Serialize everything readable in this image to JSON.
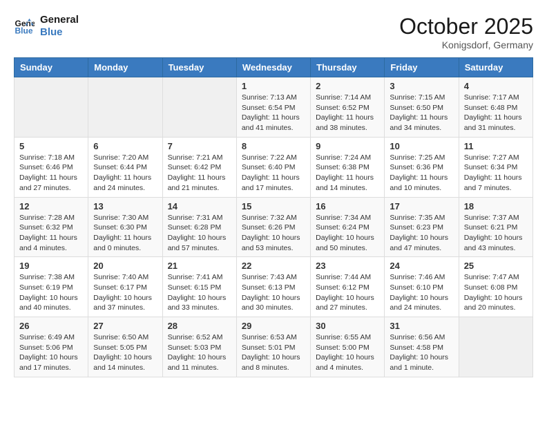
{
  "header": {
    "logo_general": "General",
    "logo_blue": "Blue",
    "month": "October 2025",
    "location": "Konigsdorf, Germany"
  },
  "weekdays": [
    "Sunday",
    "Monday",
    "Tuesday",
    "Wednesday",
    "Thursday",
    "Friday",
    "Saturday"
  ],
  "weeks": [
    [
      {
        "day": "",
        "content": ""
      },
      {
        "day": "",
        "content": ""
      },
      {
        "day": "",
        "content": ""
      },
      {
        "day": "1",
        "content": "Sunrise: 7:13 AM\nSunset: 6:54 PM\nDaylight: 11 hours and 41 minutes."
      },
      {
        "day": "2",
        "content": "Sunrise: 7:14 AM\nSunset: 6:52 PM\nDaylight: 11 hours and 38 minutes."
      },
      {
        "day": "3",
        "content": "Sunrise: 7:15 AM\nSunset: 6:50 PM\nDaylight: 11 hours and 34 minutes."
      },
      {
        "day": "4",
        "content": "Sunrise: 7:17 AM\nSunset: 6:48 PM\nDaylight: 11 hours and 31 minutes."
      }
    ],
    [
      {
        "day": "5",
        "content": "Sunrise: 7:18 AM\nSunset: 6:46 PM\nDaylight: 11 hours and 27 minutes."
      },
      {
        "day": "6",
        "content": "Sunrise: 7:20 AM\nSunset: 6:44 PM\nDaylight: 11 hours and 24 minutes."
      },
      {
        "day": "7",
        "content": "Sunrise: 7:21 AM\nSunset: 6:42 PM\nDaylight: 11 hours and 21 minutes."
      },
      {
        "day": "8",
        "content": "Sunrise: 7:22 AM\nSunset: 6:40 PM\nDaylight: 11 hours and 17 minutes."
      },
      {
        "day": "9",
        "content": "Sunrise: 7:24 AM\nSunset: 6:38 PM\nDaylight: 11 hours and 14 minutes."
      },
      {
        "day": "10",
        "content": "Sunrise: 7:25 AM\nSunset: 6:36 PM\nDaylight: 11 hours and 10 minutes."
      },
      {
        "day": "11",
        "content": "Sunrise: 7:27 AM\nSunset: 6:34 PM\nDaylight: 11 hours and 7 minutes."
      }
    ],
    [
      {
        "day": "12",
        "content": "Sunrise: 7:28 AM\nSunset: 6:32 PM\nDaylight: 11 hours and 4 minutes."
      },
      {
        "day": "13",
        "content": "Sunrise: 7:30 AM\nSunset: 6:30 PM\nDaylight: 11 hours and 0 minutes."
      },
      {
        "day": "14",
        "content": "Sunrise: 7:31 AM\nSunset: 6:28 PM\nDaylight: 10 hours and 57 minutes."
      },
      {
        "day": "15",
        "content": "Sunrise: 7:32 AM\nSunset: 6:26 PM\nDaylight: 10 hours and 53 minutes."
      },
      {
        "day": "16",
        "content": "Sunrise: 7:34 AM\nSunset: 6:24 PM\nDaylight: 10 hours and 50 minutes."
      },
      {
        "day": "17",
        "content": "Sunrise: 7:35 AM\nSunset: 6:23 PM\nDaylight: 10 hours and 47 minutes."
      },
      {
        "day": "18",
        "content": "Sunrise: 7:37 AM\nSunset: 6:21 PM\nDaylight: 10 hours and 43 minutes."
      }
    ],
    [
      {
        "day": "19",
        "content": "Sunrise: 7:38 AM\nSunset: 6:19 PM\nDaylight: 10 hours and 40 minutes."
      },
      {
        "day": "20",
        "content": "Sunrise: 7:40 AM\nSunset: 6:17 PM\nDaylight: 10 hours and 37 minutes."
      },
      {
        "day": "21",
        "content": "Sunrise: 7:41 AM\nSunset: 6:15 PM\nDaylight: 10 hours and 33 minutes."
      },
      {
        "day": "22",
        "content": "Sunrise: 7:43 AM\nSunset: 6:13 PM\nDaylight: 10 hours and 30 minutes."
      },
      {
        "day": "23",
        "content": "Sunrise: 7:44 AM\nSunset: 6:12 PM\nDaylight: 10 hours and 27 minutes."
      },
      {
        "day": "24",
        "content": "Sunrise: 7:46 AM\nSunset: 6:10 PM\nDaylight: 10 hours and 24 minutes."
      },
      {
        "day": "25",
        "content": "Sunrise: 7:47 AM\nSunset: 6:08 PM\nDaylight: 10 hours and 20 minutes."
      }
    ],
    [
      {
        "day": "26",
        "content": "Sunrise: 6:49 AM\nSunset: 5:06 PM\nDaylight: 10 hours and 17 minutes."
      },
      {
        "day": "27",
        "content": "Sunrise: 6:50 AM\nSunset: 5:05 PM\nDaylight: 10 hours and 14 minutes."
      },
      {
        "day": "28",
        "content": "Sunrise: 6:52 AM\nSunset: 5:03 PM\nDaylight: 10 hours and 11 minutes."
      },
      {
        "day": "29",
        "content": "Sunrise: 6:53 AM\nSunset: 5:01 PM\nDaylight: 10 hours and 8 minutes."
      },
      {
        "day": "30",
        "content": "Sunrise: 6:55 AM\nSunset: 5:00 PM\nDaylight: 10 hours and 4 minutes."
      },
      {
        "day": "31",
        "content": "Sunrise: 6:56 AM\nSunset: 4:58 PM\nDaylight: 10 hours and 1 minute."
      },
      {
        "day": "",
        "content": ""
      }
    ]
  ]
}
